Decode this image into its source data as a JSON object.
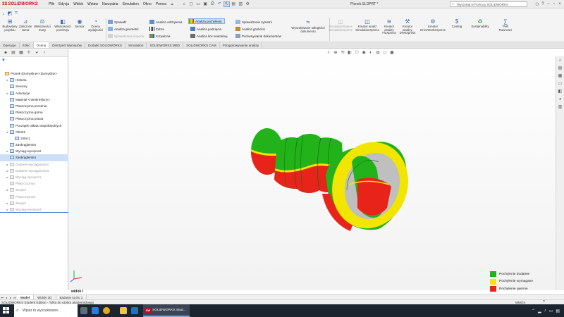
{
  "app": {
    "brand": "SOLIDWORKS",
    "document_title": "Pionek.SLDPRT *",
    "search_placeholder": "Wyszukaj w Pomocy SOLIDWORKS"
  },
  "menu": [
    "Plik",
    "Edycja",
    "Widok",
    "Wstaw",
    "Narzędzia",
    "Simulation",
    "Okno",
    "Pomoc"
  ],
  "ribbon": {
    "big_tools": [
      {
        "label": "Budowlany\nprojektu",
        "icon": "build-icon"
      },
      {
        "label": "Zaliczone\nsuma",
        "icon": "measure-icon"
      },
      {
        "label": "Właściwości\nmasy",
        "icon": "mass-properties-icon"
      },
      {
        "label": "Właściwości\nprzekroju",
        "icon": "section-properties-icon"
      },
      {
        "label": "Sensor",
        "icon": "sensor-icon"
      },
      {
        "label": "Ocena\nwydajności",
        "icon": "performance-icon"
      }
    ],
    "col1": [
      "Sprawdź",
      "Analiza geometrii",
      "Sprawdzanie importu"
    ],
    "col2": [
      "Analiza odchylenia",
      "Zebra",
      "Krzywizna"
    ],
    "col3": [
      "Analiza pochylenia",
      "Analiza podcięcia",
      "Analiza linii neutralnej"
    ],
    "col4": [
      "Sprawdzenie symetrii",
      "Analiza grubości",
      "Porównywanie dokumentów"
    ],
    "doc_tool": "Wyszukiwanie odległości dokumentu",
    "right_tools": [
      {
        "label": "SimulationXpress\nSimulationXpress",
        "dim": true
      },
      {
        "label": "Kreator analiz\nSimulationXpress",
        "dim": false
      },
      {
        "label": "Kreator\nanalizy\nFloXpress",
        "dim": false
      },
      {
        "label": "Kreator\nanalizy\nDFMXpress",
        "dim": false
      },
      {
        "label": "Kreator\nDriveWorksXpress",
        "dim": false
      },
      {
        "label": "Costing",
        "dim": false
      },
      {
        "label": "Sustainability",
        "dim": false
      },
      {
        "label": "Pełf\nRownosci",
        "dim": false
      }
    ]
  },
  "tabs": [
    "Operacje",
    "Szkic",
    "Ocena",
    "DimXpert Wymiarów",
    "Dodatki SOLIDWORKS",
    "Simulation",
    "SOLIDWORKS MBD",
    "SOLIDWORKS CAM",
    "Przygotowywanie analizy"
  ],
  "active_tab": "Ocena",
  "tree": [
    {
      "label": "Pionek (Domyślne<<Domyślne>",
      "indent": 0,
      "arrow": "",
      "kind": "root"
    },
    {
      "label": "Historia",
      "indent": 1,
      "arrow": "▸"
    },
    {
      "label": "Sensory",
      "indent": 1,
      "arrow": ""
    },
    {
      "label": "Adnotacje",
      "indent": 1,
      "arrow": "▸"
    },
    {
      "label": "Materiał <nieokreślony>",
      "indent": 1,
      "arrow": ""
    },
    {
      "label": "Płaszczyzna przednia",
      "indent": 1,
      "arrow": ""
    },
    {
      "label": "Płaszczyzna górna",
      "indent": 1,
      "arrow": ""
    },
    {
      "label": "Płaszczyzna prawa",
      "indent": 1,
      "arrow": ""
    },
    {
      "label": "Początek układu współrzędnych",
      "indent": 1,
      "arrow": ""
    },
    {
      "label": "Obrót1",
      "indent": 1,
      "arrow": "▾"
    },
    {
      "label": "Szkic1",
      "indent": 2,
      "arrow": ""
    },
    {
      "label": "Zaokrąglenie3",
      "indent": 1,
      "arrow": ""
    },
    {
      "label": "Wyciąg-wycięcie2",
      "indent": 1,
      "arrow": "▸"
    },
    {
      "label": "Zaokrąglenie4",
      "indent": 1,
      "arrow": "",
      "sel": true
    },
    {
      "label": "Dodanie-wyciągnięcie2",
      "indent": 1,
      "arrow": "▸",
      "dim": true
    },
    {
      "label": "Dodanie-wyciągnięcie3",
      "indent": 1,
      "arrow": "▸",
      "dim": true
    },
    {
      "label": "Wyciąg-wycięcie1",
      "indent": 1,
      "arrow": "▸",
      "dim": true
    },
    {
      "label": "Płaszczyzna2",
      "indent": 1,
      "arrow": "",
      "dim": true
    },
    {
      "label": "Zwoje2",
      "indent": 1,
      "arrow": "▸",
      "dim": true
    },
    {
      "label": "Płaszczyzna3",
      "indent": 1,
      "arrow": "",
      "dim": true
    },
    {
      "label": "Zwoje3",
      "indent": 1,
      "arrow": "▸",
      "dim": true
    },
    {
      "label": "Wyciąg-wycięcie3",
      "indent": 1,
      "arrow": "▸",
      "dim": true
    }
  ],
  "viewport": {
    "view_label": "widok I"
  },
  "legend": [
    {
      "label": "Pochylenie dodatnie",
      "color": "#22b21a"
    },
    {
      "label": "Pochylenie wymagane",
      "color": "#f2e600"
    },
    {
      "label": "Pochylenie ujemne",
      "color": "#e8231a"
    }
  ],
  "model_tabs": [
    "Model",
    "Widoki 3D",
    "Badanie ruchu 1"
  ],
  "status": {
    "left": "SOLIDWORKS Student Edition - Tylko do użytku akademickiego",
    "units": "MMGS",
    "help": "?"
  },
  "taskbar": {
    "search": "Wpisz tu wyszukiwane...",
    "app": "SOLIDWORKS Stud..."
  }
}
